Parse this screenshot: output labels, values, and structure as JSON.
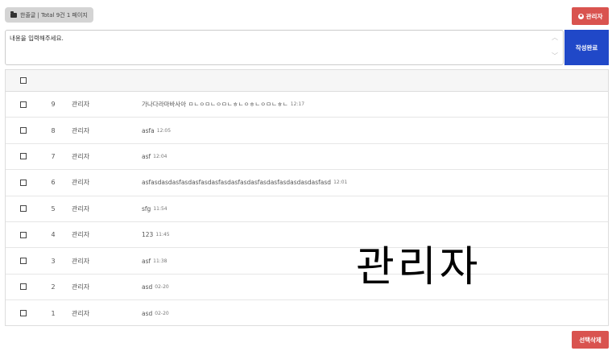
{
  "header": {
    "board_info": "한줄글 | Total 9건 1 페이지",
    "admin_label": "관리자"
  },
  "editor": {
    "placeholder": "내용을 입력해주세요.",
    "submit_label": "작성완료"
  },
  "rows": [
    {
      "num": "9",
      "writer": "관리자",
      "content": "가나다라마바사아 ㅁㄴㅇㅁㄴㅇㅁㄴㅎㄴㅇㅎㄴㅇㅁㄴㅎㄴ",
      "time": "12:17"
    },
    {
      "num": "8",
      "writer": "관리자",
      "content": "asfa",
      "time": "12:05"
    },
    {
      "num": "7",
      "writer": "관리자",
      "content": "asf",
      "time": "12:04"
    },
    {
      "num": "6",
      "writer": "관리자",
      "content": "asfasdasdasfasdasfasdasfasdasfasdasfasdasfasdasdasdasfasd",
      "time": "12:01"
    },
    {
      "num": "5",
      "writer": "관리자",
      "content": "sfg",
      "time": "11:54"
    },
    {
      "num": "4",
      "writer": "관리자",
      "content": "123",
      "time": "11:45"
    },
    {
      "num": "3",
      "writer": "관리자",
      "content": "asf",
      "time": "11:38"
    },
    {
      "num": "2",
      "writer": "관리자",
      "content": "asd",
      "time": "02-20"
    },
    {
      "num": "1",
      "writer": "관리자",
      "content": "asd",
      "time": "02-20"
    }
  ],
  "watermark": "관리자",
  "footer": {
    "delete_label": "선택삭제"
  },
  "colors": {
    "danger": "#d9534f",
    "primary": "#2048c8"
  }
}
